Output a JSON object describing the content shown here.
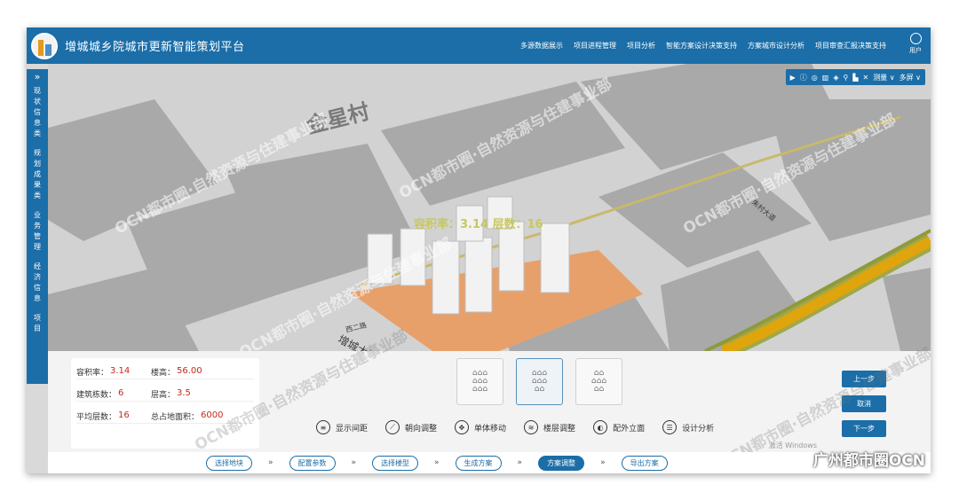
{
  "header": {
    "title": "增城城乡院城市更新智能策划平台",
    "nav": [
      "多源数据展示",
      "项目进程管理",
      "项目分析",
      "智能方案设计决策支持",
      "方案城市设计分析",
      "项目审查汇报决策支持"
    ],
    "user_label": "用户"
  },
  "sidebar": {
    "groups": [
      "现状信息类",
      "规划成果类",
      "业务管理",
      "经济信息",
      "项目"
    ]
  },
  "map": {
    "place_label": "金星村",
    "overlay": "容积率：3.14   层数：16",
    "road_labels": [
      "西二路",
      "增城大道",
      "朱村大道"
    ],
    "toolbar": [
      "测量 ∨",
      "多屏 ∨"
    ]
  },
  "params": {
    "rows": [
      {
        "k1": "容积率：",
        "v1": "3.14",
        "k2": "楼高：",
        "v2": "56.00"
      },
      {
        "k1": "建筑栋数：",
        "v1": "6",
        "k2": "层高：",
        "v2": "3.5"
      },
      {
        "k1": "平均层数：",
        "v1": "16",
        "k2": "总占地面积：",
        "v2": "6000"
      }
    ]
  },
  "actions": [
    "显示间距",
    "朝向调整",
    "单体移动",
    "楼层调整",
    "配外立面",
    "设计分析"
  ],
  "side_buttons": [
    "上一步",
    "取消",
    "下一步"
  ],
  "steps": [
    "选择地块",
    "配置参数",
    "选择楼型",
    "生成方案",
    "方案调整",
    "导出方案"
  ],
  "active_step": "方案调整",
  "watermarks": {
    "a": "OCN都市圈·自然资源与住建事业部",
    "corner": "广州都市圈OCN",
    "windows": "激活 Windows"
  },
  "colors": {
    "brand": "#1b6ea8",
    "site": "#e8a06a",
    "value": "#c42a1f"
  }
}
